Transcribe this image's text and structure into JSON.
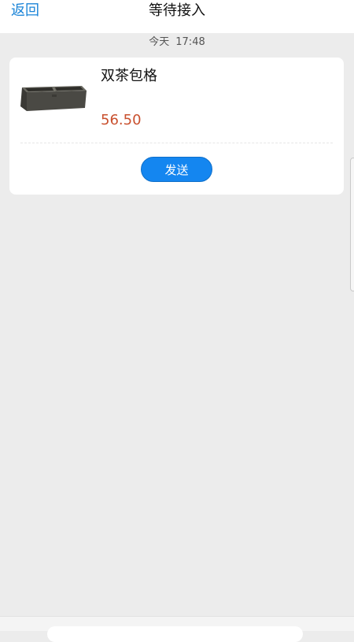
{
  "header": {
    "back_label": "返回",
    "title": "等待接入"
  },
  "chat": {
    "day_label": "今天",
    "time_label": "17:48"
  },
  "product_card": {
    "name": "双茶包格",
    "price": "56.50",
    "send_label": "发送",
    "price_color": "#c9502e"
  },
  "colors": {
    "accent": "#1486f0",
    "link": "#1a84d8",
    "background": "#ececec"
  },
  "icons": {
    "product_image": "tea-bag-box-image"
  }
}
